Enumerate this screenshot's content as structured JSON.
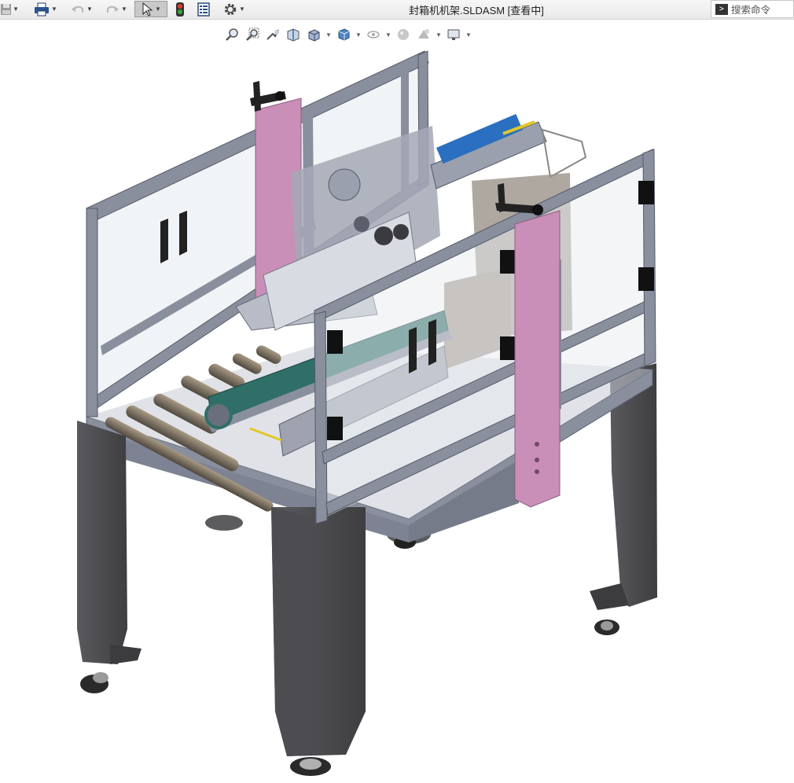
{
  "window": {
    "title": "封箱机机架.SLDASM [查看中]"
  },
  "titlebar": {
    "buttons": [
      {
        "name": "save-button",
        "icon": "save-icon",
        "dropdown": true
      },
      {
        "name": "print-button",
        "icon": "printer-icon",
        "dropdown": true
      },
      {
        "name": "undo-button",
        "icon": "undo-icon",
        "dropdown": true
      },
      {
        "name": "redo-button",
        "icon": "redo-icon",
        "dropdown": true
      },
      {
        "name": "select-button",
        "icon": "cursor-icon",
        "dropdown": true,
        "active": true
      },
      {
        "name": "rebuild-button",
        "icon": "traffic-light-icon",
        "dropdown": false
      },
      {
        "name": "file-properties-button",
        "icon": "properties-icon",
        "dropdown": false
      },
      {
        "name": "options-button",
        "icon": "gear-icon",
        "dropdown": true
      }
    ]
  },
  "search": {
    "placeholder": "搜索命令",
    "icon": "terminal-icon"
  },
  "heads_up_toolbar": [
    "zoom-to-fit-icon",
    "zoom-to-area-icon",
    "previous-view-icon",
    "section-view-icon",
    "view-orientation-icon",
    "display-style-icon",
    "hide-show-items-icon",
    "edit-appearance-icon",
    "apply-scene-icon",
    "view-settings-icon"
  ],
  "colors": {
    "frame": "#8a8f9e",
    "leg": "#4a4a4d",
    "belt": "#2f6f68",
    "post": "#c98fb8",
    "cylinder": "#2a6fc0",
    "roller": "#7c7263",
    "glass": "#e8ecf0"
  }
}
